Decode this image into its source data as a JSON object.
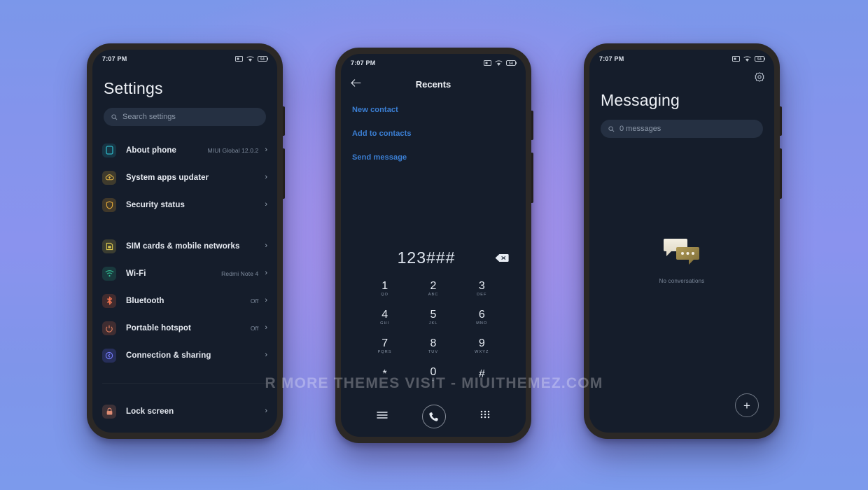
{
  "background": {
    "accent": "#8a93ee",
    "base": "#7b97ea"
  },
  "watermark": {
    "text": "R MORE THEMES VISIT - MIUITHEMEZ.COM"
  },
  "statusbar": {
    "time": "7:07 PM",
    "battery": "54",
    "icons": [
      "sim-icon",
      "wifi-icon",
      "battery-icon"
    ]
  },
  "settings_phone": {
    "title": "Settings",
    "search": {
      "placeholder": "Search settings",
      "icon": "search-icon"
    },
    "group1": [
      {
        "label": "About phone",
        "value": "MIUI Global 12.0.2",
        "icon": "phone-outline-icon",
        "color": "#1f8f9e"
      },
      {
        "label": "System apps updater",
        "value": "",
        "icon": "cloud-icon",
        "color": "#d6a836"
      },
      {
        "label": "Security status",
        "value": "",
        "icon": "shield-icon",
        "color": "#d99a2b"
      }
    ],
    "group2": [
      {
        "label": "SIM cards & mobile networks",
        "value": "",
        "icon": "sim-card-icon",
        "color": "#d6c04a"
      },
      {
        "label": "Wi-Fi",
        "value": "Redmi Note 4",
        "icon": "wifi-icon",
        "color": "#27a07e"
      },
      {
        "label": "Bluetooth",
        "value": "Off",
        "icon": "bluetooth-icon",
        "color": "#e0603a"
      },
      {
        "label": "Portable hotspot",
        "value": "Off",
        "icon": "hotspot-icon",
        "color": "#d96a4a"
      },
      {
        "label": "Connection & sharing",
        "value": "",
        "icon": "share-icon",
        "color": "#5a5fe0"
      }
    ],
    "group3": [
      {
        "label": "Lock screen",
        "value": "",
        "icon": "lock-icon",
        "color": "#cf7a62"
      }
    ],
    "chevron": "›"
  },
  "dialer_phone": {
    "title": "Recents",
    "back_icon": "back-arrow-icon",
    "actions": [
      {
        "label": "New contact"
      },
      {
        "label": "Add to contacts"
      },
      {
        "label": "Send message"
      }
    ],
    "action_color": "#3b7fd4",
    "number": "123###",
    "backspace_icon": "backspace-icon",
    "keys": [
      {
        "num": "1",
        "sub": "QO"
      },
      {
        "num": "2",
        "sub": "ABC"
      },
      {
        "num": "3",
        "sub": "DEF"
      },
      {
        "num": "4",
        "sub": "GHI"
      },
      {
        "num": "5",
        "sub": "JKL"
      },
      {
        "num": "6",
        "sub": "MNO"
      },
      {
        "num": "7",
        "sub": "PQRS"
      },
      {
        "num": "8",
        "sub": "TUV"
      },
      {
        "num": "9",
        "sub": "WXYZ"
      },
      {
        "num": "*",
        "sub": ""
      },
      {
        "num": "0",
        "sub": "+"
      },
      {
        "num": "#",
        "sub": ""
      }
    ],
    "bottom": {
      "menu_icon": "hamburger-menu-icon",
      "call_icon": "call-icon",
      "keypad_icon": "keypad-grid-icon"
    }
  },
  "messaging_phone": {
    "settings_icon": "gear-icon",
    "title": "Messaging",
    "search": {
      "placeholder": "0 messages",
      "icon": "search-icon"
    },
    "empty": {
      "icon": "chat-bubbles-icon",
      "caption": "No conversations"
    },
    "fab": {
      "icon": "plus-icon",
      "label": "+"
    }
  }
}
